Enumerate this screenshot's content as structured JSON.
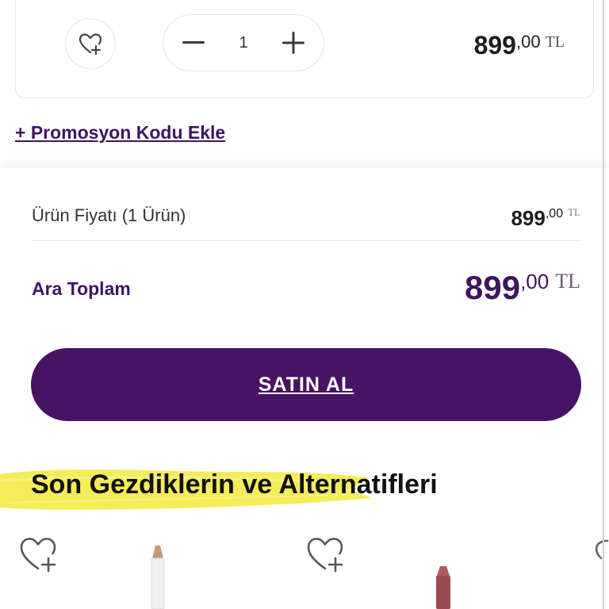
{
  "cart_item": {
    "quantity": "1",
    "price_int": "899",
    "price_dec": ",00",
    "currency": "TL"
  },
  "promo": {
    "label": "+ Promosyon Kodu Ekle"
  },
  "summary": {
    "product_price_label": "Ürün Fiyatı (1 Ürün)",
    "product_price_int": "899",
    "product_price_dec": ",00",
    "product_price_currency": "TL",
    "subtotal_label": "Ara Toplam",
    "subtotal_int": "899",
    "subtotal_dec": ",00",
    "subtotal_currency": "TL"
  },
  "buy_button": {
    "label": "SATIN AL"
  },
  "recent": {
    "title": "Son Gezdiklerin ve Alternatifleri"
  },
  "icons": {
    "favorite": "heart-plus-icon",
    "decrease": "minus-icon",
    "increase": "plus-icon"
  },
  "colors": {
    "brand_purple": "#461462",
    "text_purple": "#3f145f",
    "highlight_yellow": "#f2ea3c"
  }
}
